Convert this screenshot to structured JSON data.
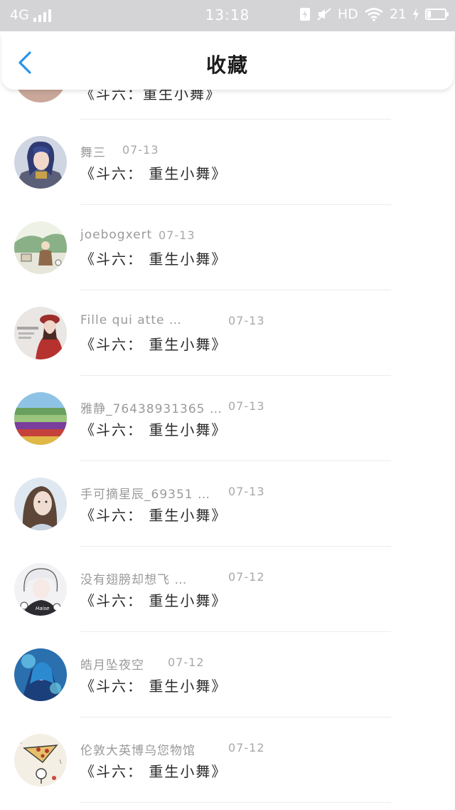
{
  "status_bar": {
    "network": "4G",
    "time": "13:18",
    "hd": "HD",
    "battery_text": "21",
    "battery_level": 0.21
  },
  "header": {
    "title": "收藏"
  },
  "partial_row": {
    "book": "《斗六：重生小舞》"
  },
  "items": [
    {
      "user": "舞三",
      "date": "07-13",
      "book": "《斗六：  重生小舞》",
      "avatar": "avatar-knight"
    },
    {
      "user": "joebogxert",
      "date": "07-13",
      "book": "《斗六：  重生小舞》",
      "avatar": "avatar-landscape-cartoon"
    },
    {
      "user": "Fille qui atte …",
      "date": "07-13",
      "book": "《斗六：  重生小舞》",
      "avatar": "avatar-girl-red-hat"
    },
    {
      "user": "雅静_76438931365 …",
      "date": "07-13",
      "book": "《斗六：  重生小舞》",
      "avatar": "avatar-flower-field"
    },
    {
      "user": "手可摘星辰_69351 …",
      "date": "07-13",
      "book": "《斗六：  重生小舞》",
      "avatar": "avatar-girl-portrait"
    },
    {
      "user": "没有翅膀却想飞 …",
      "date": "07-12",
      "book": "《斗六：  重生小舞》",
      "avatar": "avatar-anime-boy",
      "avatar_text": "Haise"
    },
    {
      "user": "皓月坠夜空",
      "date": "07-12",
      "book": "《斗六：  重生小舞》",
      "avatar": "avatar-blue-warrior"
    },
    {
      "user": "伦敦大英博乌您物馆",
      "date": "07-12",
      "book": "《斗六：  重生小舞》",
      "avatar": "avatar-pizza-doodle"
    }
  ],
  "colors": {
    "accent": "#2b93e6",
    "status_bar": "#d4d4d6"
  }
}
